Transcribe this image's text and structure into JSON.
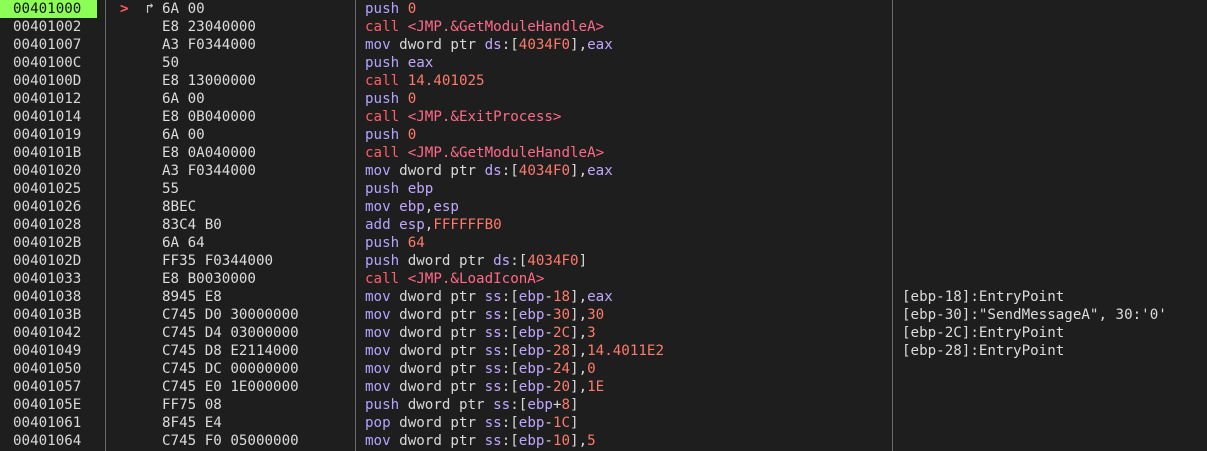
{
  "colors": {
    "background": "#1e1e1e",
    "current_address_highlight": "#8cff57",
    "mnemonic": "#b4a4ff",
    "call_mnemonic": "#ff5e6a",
    "register": "#c0a8ff",
    "number": "#ff7a6a",
    "separator": "#6a6a6a"
  },
  "markers": {
    "instruction_pointer": ">",
    "jump_target_arrow": "↱"
  },
  "rows": [
    {
      "addr": "00401000",
      "bytes": "6A 00",
      "tokens": [
        [
          "push ",
          "m"
        ],
        [
          "0",
          "n"
        ]
      ],
      "comment": "",
      "current": true
    },
    {
      "addr": "00401002",
      "bytes": "E8 23040000",
      "tokens": [
        [
          "call ",
          "mc"
        ],
        [
          "<JMP.&GetModuleHandleA>",
          "lbl"
        ]
      ],
      "comment": ""
    },
    {
      "addr": "00401007",
      "bytes": "A3 F0344000",
      "tokens": [
        [
          "mov ",
          "m"
        ],
        [
          "dword ptr ",
          "k"
        ],
        [
          "ds",
          "r"
        ],
        [
          ":[",
          "p"
        ],
        [
          "4034F0",
          "n"
        ],
        [
          "],",
          "p"
        ],
        [
          "eax",
          "r"
        ]
      ],
      "comment": ""
    },
    {
      "addr": "0040100C",
      "bytes": "50",
      "tokens": [
        [
          "push ",
          "m"
        ],
        [
          "eax",
          "r"
        ]
      ],
      "comment": ""
    },
    {
      "addr": "0040100D",
      "bytes": "E8 13000000",
      "tokens": [
        [
          "call ",
          "mc"
        ],
        [
          "14.401025",
          "n"
        ]
      ],
      "comment": ""
    },
    {
      "addr": "00401012",
      "bytes": "6A 00",
      "tokens": [
        [
          "push ",
          "m"
        ],
        [
          "0",
          "n"
        ]
      ],
      "comment": ""
    },
    {
      "addr": "00401014",
      "bytes": "E8 0B040000",
      "tokens": [
        [
          "call ",
          "mc"
        ],
        [
          "<JMP.&ExitProcess>",
          "lbl"
        ]
      ],
      "comment": ""
    },
    {
      "addr": "00401019",
      "bytes": "6A 00",
      "tokens": [
        [
          "push ",
          "m"
        ],
        [
          "0",
          "n"
        ]
      ],
      "comment": ""
    },
    {
      "addr": "0040101B",
      "bytes": "E8 0A040000",
      "tokens": [
        [
          "call ",
          "mc"
        ],
        [
          "<JMP.&GetModuleHandleA>",
          "lbl"
        ]
      ],
      "comment": ""
    },
    {
      "addr": "00401020",
      "bytes": "A3 F0344000",
      "tokens": [
        [
          "mov ",
          "m"
        ],
        [
          "dword ptr ",
          "k"
        ],
        [
          "ds",
          "r"
        ],
        [
          ":[",
          "p"
        ],
        [
          "4034F0",
          "n"
        ],
        [
          "],",
          "p"
        ],
        [
          "eax",
          "r"
        ]
      ],
      "comment": ""
    },
    {
      "addr": "00401025",
      "bytes": "55",
      "tokens": [
        [
          "push ",
          "m"
        ],
        [
          "ebp",
          "r"
        ]
      ],
      "comment": ""
    },
    {
      "addr": "00401026",
      "bytes": "8BEC",
      "tokens": [
        [
          "mov ",
          "m"
        ],
        [
          "ebp",
          "r"
        ],
        [
          ",",
          "p"
        ],
        [
          "esp",
          "r"
        ]
      ],
      "comment": ""
    },
    {
      "addr": "00401028",
      "bytes": "83C4 B0",
      "tokens": [
        [
          "add ",
          "m"
        ],
        [
          "esp",
          "r"
        ],
        [
          ",",
          "p"
        ],
        [
          "FFFFFFB0",
          "n"
        ]
      ],
      "comment": ""
    },
    {
      "addr": "0040102B",
      "bytes": "6A 64",
      "tokens": [
        [
          "push ",
          "m"
        ],
        [
          "64",
          "n"
        ]
      ],
      "comment": ""
    },
    {
      "addr": "0040102D",
      "bytes": "FF35 F0344000",
      "tokens": [
        [
          "push ",
          "m"
        ],
        [
          "dword ptr ",
          "k"
        ],
        [
          "ds",
          "r"
        ],
        [
          ":[",
          "p"
        ],
        [
          "4034F0",
          "n"
        ],
        [
          "]",
          "p"
        ]
      ],
      "comment": ""
    },
    {
      "addr": "00401033",
      "bytes": "E8 B0030000",
      "tokens": [
        [
          "call ",
          "mc"
        ],
        [
          "<JMP.&LoadIconA>",
          "lbl"
        ]
      ],
      "comment": ""
    },
    {
      "addr": "00401038",
      "bytes": "8945 E8",
      "tokens": [
        [
          "mov ",
          "m"
        ],
        [
          "dword ptr ",
          "k"
        ],
        [
          "ss",
          "r"
        ],
        [
          ":[",
          "p"
        ],
        [
          "ebp",
          "r"
        ],
        [
          "-",
          "p"
        ],
        [
          "18",
          "n"
        ],
        [
          "],",
          "p"
        ],
        [
          "eax",
          "r"
        ]
      ],
      "comment": "[ebp-18]:EntryPoint"
    },
    {
      "addr": "0040103B",
      "bytes": "C745 D0 30000000",
      "tokens": [
        [
          "mov ",
          "m"
        ],
        [
          "dword ptr ",
          "k"
        ],
        [
          "ss",
          "r"
        ],
        [
          ":[",
          "p"
        ],
        [
          "ebp",
          "r"
        ],
        [
          "-",
          "p"
        ],
        [
          "30",
          "n"
        ],
        [
          "],",
          "p"
        ],
        [
          "30",
          "n"
        ]
      ],
      "comment": "[ebp-30]:\"SendMessageA\", 30:'0'"
    },
    {
      "addr": "00401042",
      "bytes": "C745 D4 03000000",
      "tokens": [
        [
          "mov ",
          "m"
        ],
        [
          "dword ptr ",
          "k"
        ],
        [
          "ss",
          "r"
        ],
        [
          ":[",
          "p"
        ],
        [
          "ebp",
          "r"
        ],
        [
          "-",
          "p"
        ],
        [
          "2C",
          "n"
        ],
        [
          "],",
          "p"
        ],
        [
          "3",
          "n"
        ]
      ],
      "comment": "[ebp-2C]:EntryPoint"
    },
    {
      "addr": "00401049",
      "bytes": "C745 D8 E2114000",
      "tokens": [
        [
          "mov ",
          "m"
        ],
        [
          "dword ptr ",
          "k"
        ],
        [
          "ss",
          "r"
        ],
        [
          ":[",
          "p"
        ],
        [
          "ebp",
          "r"
        ],
        [
          "-",
          "p"
        ],
        [
          "28",
          "n"
        ],
        [
          "],",
          "p"
        ],
        [
          "14.4011E2",
          "n"
        ]
      ],
      "comment": "[ebp-28]:EntryPoint"
    },
    {
      "addr": "00401050",
      "bytes": "C745 DC 00000000",
      "tokens": [
        [
          "mov ",
          "m"
        ],
        [
          "dword ptr ",
          "k"
        ],
        [
          "ss",
          "r"
        ],
        [
          ":[",
          "p"
        ],
        [
          "ebp",
          "r"
        ],
        [
          "-",
          "p"
        ],
        [
          "24",
          "n"
        ],
        [
          "],",
          "p"
        ],
        [
          "0",
          "n"
        ]
      ],
      "comment": ""
    },
    {
      "addr": "00401057",
      "bytes": "C745 E0 1E000000",
      "tokens": [
        [
          "mov ",
          "m"
        ],
        [
          "dword ptr ",
          "k"
        ],
        [
          "ss",
          "r"
        ],
        [
          ":[",
          "p"
        ],
        [
          "ebp",
          "r"
        ],
        [
          "-",
          "p"
        ],
        [
          "20",
          "n"
        ],
        [
          "],",
          "p"
        ],
        [
          "1E",
          "n"
        ]
      ],
      "comment": ""
    },
    {
      "addr": "0040105E",
      "bytes": "FF75 08",
      "tokens": [
        [
          "push ",
          "m"
        ],
        [
          "dword ptr ",
          "k"
        ],
        [
          "ss",
          "r"
        ],
        [
          ":[",
          "p"
        ],
        [
          "ebp",
          "r"
        ],
        [
          "+",
          "p"
        ],
        [
          "8",
          "n"
        ],
        [
          "]",
          "p"
        ]
      ],
      "comment": ""
    },
    {
      "addr": "00401061",
      "bytes": "8F45 E4",
      "tokens": [
        [
          "pop ",
          "m"
        ],
        [
          "dword ptr ",
          "k"
        ],
        [
          "ss",
          "r"
        ],
        [
          ":[",
          "p"
        ],
        [
          "ebp",
          "r"
        ],
        [
          "-",
          "p"
        ],
        [
          "1C",
          "n"
        ],
        [
          "]",
          "p"
        ]
      ],
      "comment": ""
    },
    {
      "addr": "00401064",
      "bytes": "C745 F0 05000000",
      "tokens": [
        [
          "mov ",
          "m"
        ],
        [
          "dword ptr ",
          "k"
        ],
        [
          "ss",
          "r"
        ],
        [
          ":[",
          "p"
        ],
        [
          "ebp",
          "r"
        ],
        [
          "-",
          "p"
        ],
        [
          "10",
          "n"
        ],
        [
          "],",
          "p"
        ],
        [
          "5",
          "n"
        ]
      ],
      "comment": ""
    }
  ]
}
